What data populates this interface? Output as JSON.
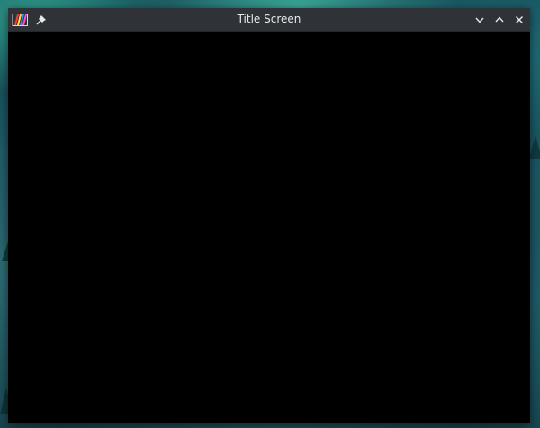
{
  "window": {
    "title": "Title Screen",
    "app_icon": "rainbow-stripes-icon",
    "pin_icon": "pin-icon",
    "controls": {
      "minimize_icon": "chevron-down-icon",
      "maximize_icon": "chevron-up-icon",
      "close_icon": "close-icon"
    },
    "content_color": "#000000",
    "titlebar_color": "#2f3338"
  },
  "desktop": {
    "accent_color": "#2f9e8e"
  }
}
